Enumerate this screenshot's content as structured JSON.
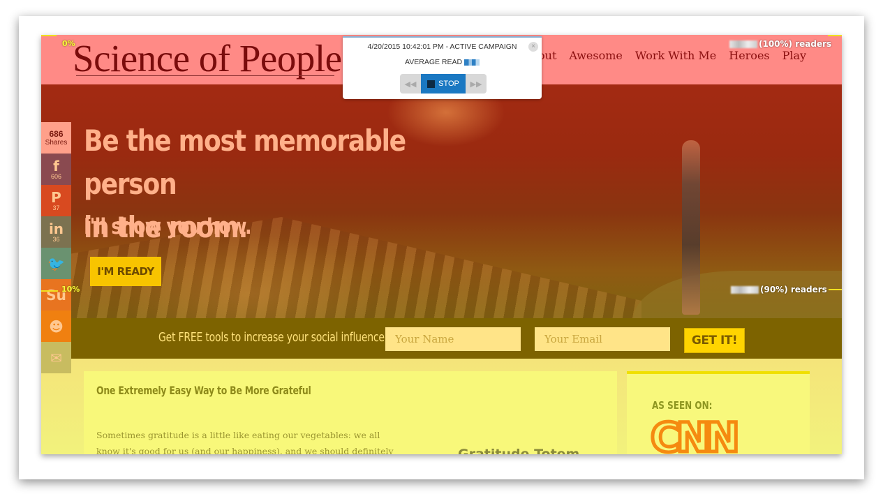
{
  "site": {
    "logo": "Science of People",
    "nav": [
      "About",
      "Awesome",
      "Work With Me",
      "Heroes",
      "Play"
    ],
    "nav_partial_first": "out"
  },
  "hero": {
    "headline_line1": "Be the most memorable person",
    "headline_line2": "in the room.",
    "subheadline": "I'll show you how.",
    "cta_label": "I'M READY"
  },
  "optin": {
    "text": "Get FREE tools to increase your social influence",
    "name_placeholder": "Your Name",
    "email_placeholder": "Your Email",
    "submit_label": "GET IT!"
  },
  "article": {
    "title": "One Extremely Easy Way to Be More Grateful",
    "body": "Sometimes gratitude is a little like eating our vegetables: we all know it's good for us (and our happiness), and we should definitely do it on a daily",
    "subhead": "Gratitude Totem"
  },
  "sidebar": {
    "as_seen_on": "AS SEEN ON:",
    "logo_cnn": "CNN"
  },
  "share": {
    "total": "686",
    "total_label": "Shares",
    "items": [
      {
        "network": "facebook",
        "icon": "facebook-icon",
        "glyph": "f",
        "count": "606"
      },
      {
        "network": "pinterest",
        "icon": "pinterest-icon",
        "glyph": "P",
        "count": "37"
      },
      {
        "network": "linkedin",
        "icon": "linkedin-icon",
        "glyph": "in",
        "count": "36"
      },
      {
        "network": "twitter",
        "icon": "twitter-icon",
        "glyph": "🐦",
        "count": ""
      },
      {
        "network": "stumbleupon",
        "icon": "stumbleupon-icon",
        "glyph": "Su",
        "count": ""
      },
      {
        "network": "reddit",
        "icon": "reddit-icon",
        "glyph": "☻",
        "count": ""
      },
      {
        "network": "email",
        "icon": "email-icon",
        "glyph": "✉",
        "count": ""
      }
    ]
  },
  "heatmap": {
    "marker_top": "0%",
    "marker_10": "10%",
    "readers_100": "(100%) readers",
    "readers_90": "(90%) readers"
  },
  "playback": {
    "timestamp_line": "4/20/2015 10:42:01 PM - ACTIVE CAMPAIGN",
    "average_read_label": "AVERAGE READ",
    "close_glyph": "×",
    "prev_glyph": "◀◀",
    "stop_label": "STOP",
    "next_glyph": "▶▶"
  },
  "colors": {
    "header_overlay": "#ff8a86",
    "cta_yellow": "#f8c400",
    "stop_blue": "#1a78c2",
    "marker_yellow": "#f8f83a"
  }
}
